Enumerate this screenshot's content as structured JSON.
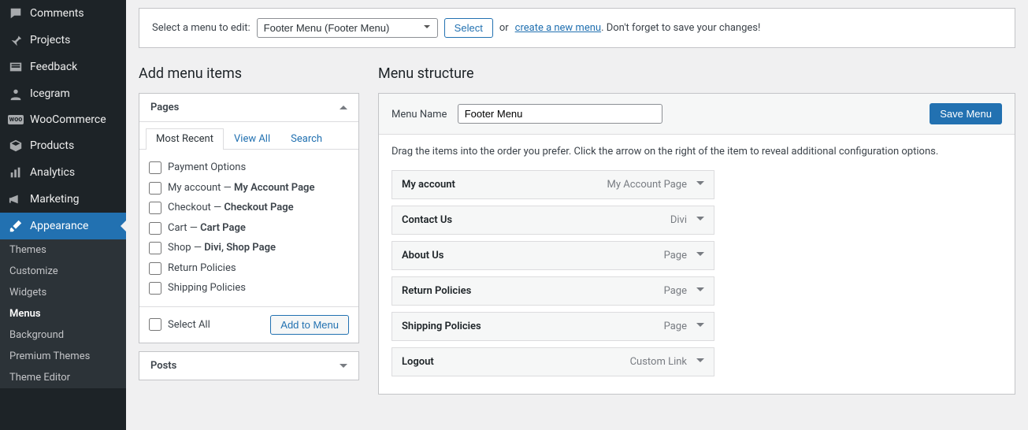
{
  "sidebar": {
    "items": [
      {
        "label": "Comments",
        "icon": "comment"
      },
      {
        "label": "Projects",
        "icon": "pin"
      },
      {
        "label": "Feedback",
        "icon": "feedback"
      },
      {
        "label": "Icegram",
        "icon": "user"
      },
      {
        "label": "WooCommerce",
        "icon": "woo"
      },
      {
        "label": "Products",
        "icon": "package"
      },
      {
        "label": "Analytics",
        "icon": "bars"
      },
      {
        "label": "Marketing",
        "icon": "megaphone"
      },
      {
        "label": "Appearance",
        "icon": "brush"
      }
    ],
    "active_index": 8,
    "sub": [
      {
        "label": "Themes"
      },
      {
        "label": "Customize"
      },
      {
        "label": "Widgets"
      },
      {
        "label": "Menus"
      },
      {
        "label": "Background"
      },
      {
        "label": "Premium Themes"
      },
      {
        "label": "Theme Editor"
      }
    ],
    "sub_active_index": 3
  },
  "selectbar": {
    "label": "Select a menu to edit:",
    "selected": "Footer Menu (Footer Menu)",
    "select_btn": "Select",
    "or": "or",
    "link": "create a new menu",
    "tail": ". Don't forget to save your changes!"
  },
  "headings": {
    "add": "Add menu items",
    "structure": "Menu structure"
  },
  "pages_panel": {
    "title": "Pages",
    "tabs": [
      {
        "label": "Most Recent"
      },
      {
        "label": "View All"
      },
      {
        "label": "Search"
      }
    ],
    "active_tab": 0,
    "items": [
      {
        "label": "Payment Options",
        "suffix": ""
      },
      {
        "label": "My account",
        "suffix": "My Account Page"
      },
      {
        "label": "Checkout",
        "suffix": "Checkout Page"
      },
      {
        "label": "Cart",
        "suffix": "Cart Page"
      },
      {
        "label": "Shop",
        "suffix": "Divi, Shop Page"
      },
      {
        "label": "Return Policies",
        "suffix": ""
      },
      {
        "label": "Shipping Policies",
        "suffix": ""
      }
    ],
    "select_all": "Select All",
    "add_btn": "Add to Menu"
  },
  "posts_panel": {
    "title": "Posts"
  },
  "menu_structure": {
    "menu_name_label": "Menu Name",
    "menu_name_value": "Footer Menu",
    "save_btn": "Save Menu",
    "help": "Drag the items into the order you prefer. Click the arrow on the right of the item to reveal additional configuration options.",
    "items": [
      {
        "title": "My account",
        "type": "My Account Page"
      },
      {
        "title": "Contact Us",
        "type": "Divi"
      },
      {
        "title": "About Us",
        "type": "Page"
      },
      {
        "title": "Return Policies",
        "type": "Page"
      },
      {
        "title": "Shipping Policies",
        "type": "Page"
      },
      {
        "title": "Logout",
        "type": "Custom Link"
      }
    ]
  }
}
